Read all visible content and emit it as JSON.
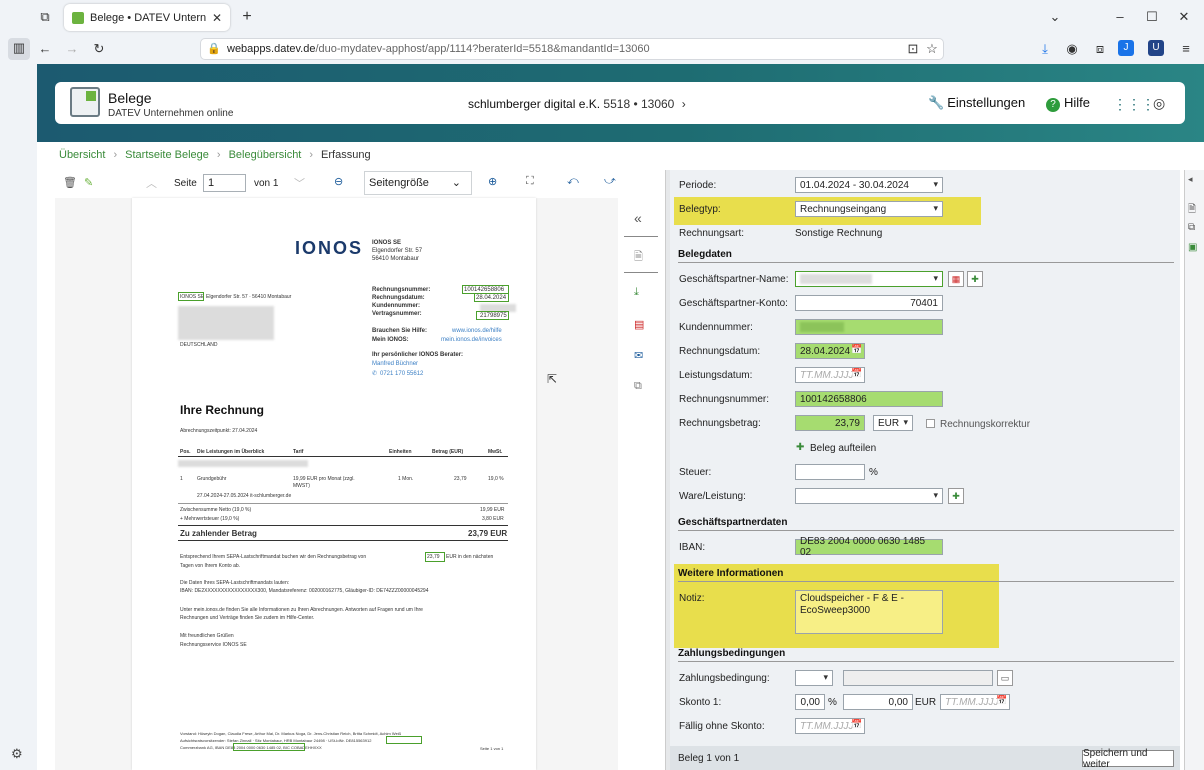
{
  "browser": {
    "tab_title": "Belege • DATEV Unternehmen o",
    "url_host": "webapps.datev.de",
    "url_path": "/duo-mydatev-apphost/app/1114?beraterId=5518&mandantId=13060"
  },
  "header": {
    "app_title": "Belege",
    "app_subtitle": "DATEV Unternehmen online",
    "client_name": "schlumberger digital e.K.",
    "client_ids": "5518 • 13060",
    "settings_label": "Einstellungen",
    "help_label": "Hilfe"
  },
  "breadcrumb": [
    "Übersicht",
    "Startseite Belege",
    "Belegübersicht",
    "Erfassung"
  ],
  "doc_toolbar": {
    "page_label": "Seite",
    "page_value": "1",
    "of_label": "von 1",
    "zoom_value": "Seitengröße"
  },
  "document": {
    "logo": "IONOS",
    "sender_name": "IONOS SE",
    "sender_street": "Elgendorfer Str. 57",
    "sender_city": "56410 Montabaur",
    "return_line_company": "IONOS SE",
    "return_line_rest": "Elgendorfer Str. 57 · 56410 Montabaur",
    "country": "DEUTSCHLAND",
    "meta_labels": [
      "Rechnungsnummer:",
      "Rechnungsdatum:",
      "Kundennummer:",
      "Vertragsnummer:"
    ],
    "meta_values": [
      "100142658806",
      "28.04.2024",
      "",
      "21798975"
    ],
    "help_label": "Brauchen Sie Hilfe:",
    "help_link": "www.ionos.de/hilfe",
    "my_label": "Mein IONOS:",
    "my_link": "mein.ionos.de/invoices",
    "advisor_label": "Ihr persönlicher IONOS Berater:",
    "advisor_name": "Manfred Büchner",
    "advisor_phone": "0721 170 55612",
    "title": "Ihre Rechnung",
    "period": "Abrechnungszeitpunkt: 27.04.2024",
    "table_headers": [
      "Pos.",
      "Die Leistungen im Überblick",
      "Tarif",
      "Einheiten",
      "Betrag (EUR)",
      "MwSt."
    ],
    "row_pos": "1",
    "row_item": "Grundgebühr",
    "row_tarif": "19,99 EUR pro Monat (zzgl. MWST)",
    "row_units": "1 Mon.",
    "row_amount": "23,79",
    "row_vat": "19,0 %",
    "row_detail": "27.04.2024-27.05.2024 it-schlumberger.de",
    "subtotal_label": "Zwischensumme Netto (19,0 %)",
    "subtotal_value": "19,99 EUR",
    "vat_label": "+ Mehrwertsteuer (19,0 %)",
    "vat_value": "3,80 EUR",
    "total_label": "Zu zahlender Betrag",
    "total_value": "23,79 EUR",
    "sepa_text_1": "Entsprechend Ihrem SEPA-Lastschriftmandat buchen wir den Rechnungsbetrag von",
    "sepa_amount": "23,79",
    "sepa_text_2": "EUR in den nächsten",
    "sepa_text_3": "Tagen von Ihrem Konto ab.",
    "mandate_title": "Die Daten Ihres SEPA-Lastschriftmandats lauten:",
    "mandate_line": "IBAN: DE2XXXXXXXXXXXXXXXX300, Mandatsreferenz: 002000162775, Gläubiger-ID: DE74ZZZ00000045294",
    "info_line_1": "Unter mein.ionos.de finden Sie alle Informationen zu Ihren Abrechnungen. Antworten auf Fragen rund um Ihre",
    "info_line_2": "Rechnungen und Verträge finden Sie zudem im Hilfe-Center.",
    "greeting": "Mit freundlichen Grüßen",
    "signature": "Rechnungsservice IONOS SE",
    "footer_1": "Vorstand: Hüseyin Dogan, Claudia Frese, Arthur Mai, Dr. Markus Noga, Dr. Jens-Christian Reich, Britta Schmidt, Achim Weiß",
    "footer_2": "Aufsichtsratsvorsitzender: Stefan Zinnall · Sitz Montabaur, HRB Montabaur 24498 · USt-IdNr. DE815563912",
    "footer_3": "Commerzbank AG, IBAN DE83 2004 0000 0630 1485 02, BIC COBADEHHXXX",
    "page_footer": "Seite 1 von 1"
  },
  "form": {
    "periode_label": "Periode:",
    "periode_value": "01.04.2024 - 30.04.2024",
    "belegtyp_label": "Belegtyp:",
    "belegtyp_value": "Rechnungseingang",
    "rechnungsart_label": "Rechnungsart:",
    "rechnungsart_value": "Sonstige Rechnung",
    "section_belegdaten": "Belegdaten",
    "gp_name_label": "Geschäftspartner-Name:",
    "gp_konto_label": "Geschäftspartner-Konto:",
    "gp_konto_value": "70401",
    "kundennr_label": "Kundennummer:",
    "rechnungsdatum_label": "Rechnungsdatum:",
    "rechnungsdatum_value": "28.04.2024",
    "leistungsdatum_label": "Leistungsdatum:",
    "date_placeholder": "TT.MM.JJJJ",
    "rechnungsnr_label": "Rechnungsnummer:",
    "rechnungsnr_value": "100142658806",
    "betrag_label": "Rechnungsbetrag:",
    "betrag_value": "23,79",
    "currency_value": "EUR",
    "korrektur_label": "Rechnungskorrektur",
    "split_label": "Beleg aufteilen",
    "steuer_label": "Steuer:",
    "percent": "%",
    "ware_label": "Ware/Leistung:",
    "section_gp": "Geschäftspartnerdaten",
    "iban_label": "IBAN:",
    "iban_value": "DE83 2004 0000 0630 1485 02",
    "section_weitere": "Weitere Informationen",
    "notiz_label": "Notiz:",
    "notiz_value": "Cloudspeicher - F & E - EcoSweep3000",
    "section_zahlung": "Zahlungsbedingungen",
    "zahlungsbed_label": "Zahlungsbedingung:",
    "skonto_label": "Skonto 1:",
    "skonto_pct": "0,00",
    "skonto_amount": "0,00",
    "skonto_currency": "EUR",
    "faellig_label": "Fällig ohne Skonto:"
  },
  "status": {
    "beleg_count": "Beleg 1 von 1",
    "save_label": "Speichern und weiter"
  }
}
